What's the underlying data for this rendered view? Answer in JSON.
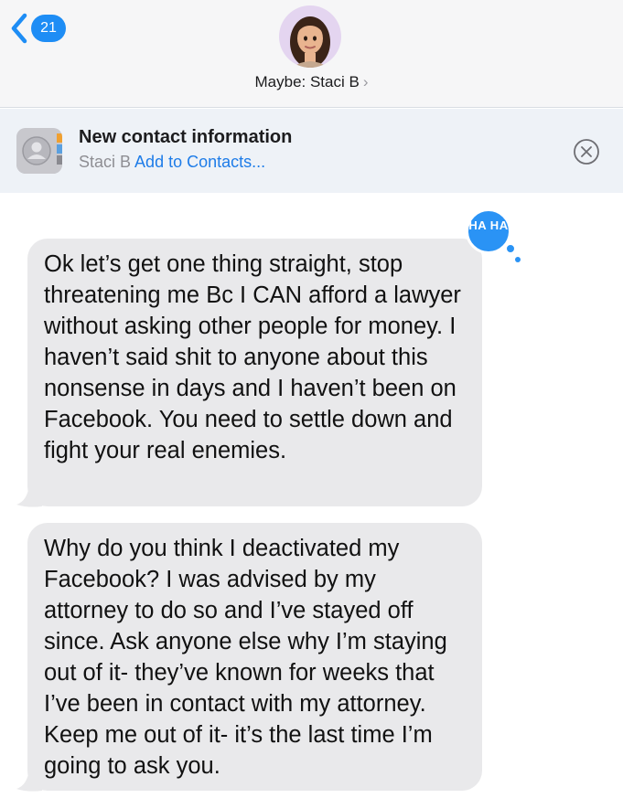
{
  "header": {
    "unread_count": "21",
    "contact_label": "Maybe: Staci B",
    "contact_chevron": "›"
  },
  "banner": {
    "title": "New contact information",
    "name": "Staci B",
    "action": "Add to Contacts..."
  },
  "messages": [
    {
      "text": "Ok let’s get one thing straight, stop threatening me Bc I CAN afford a lawyer without asking other people for money. I haven’t said shit to anyone about this nonsense in days and I haven’t been on Facebook. You need to settle down and fight your real enemies.",
      "tapback": "HA HA"
    },
    {
      "text": "Why do you think I deactivated my Facebook? I was advised by my attorney to do so and I’ve stayed off since. Ask anyone else why I’m staying out of it- they’ve known for weeks that I’ve been in contact with my attorney. Keep me out of it- it’s the last time I’m going to ask you."
    }
  ],
  "colors": {
    "accent": "#1e8df5",
    "bubble_gray": "#e9e9eb",
    "link": "#1e7ce8"
  },
  "icons": {
    "back": "chevron-left-icon",
    "contacts": "contacts-app-icon",
    "close": "close-circle-icon",
    "avatar": "memoji-avatar"
  }
}
